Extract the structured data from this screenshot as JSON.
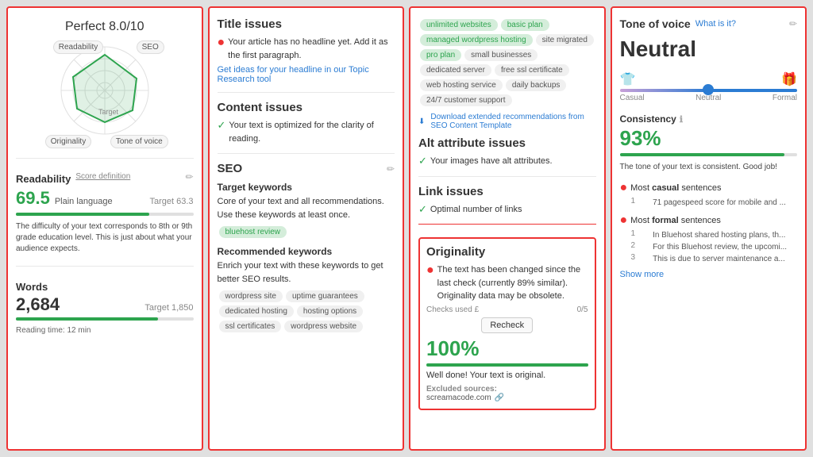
{
  "panel1": {
    "score": "Perfect 8.0",
    "score_suffix": "/10",
    "labels": {
      "readability": "Readability",
      "seo": "SEO",
      "originality": "Originality",
      "tone": "Tone of voice",
      "target": "Target"
    },
    "readability": {
      "title": "Readability",
      "score_def": "Score definition",
      "value": "69.5",
      "sublabel": "Plain language",
      "target": "Target 63.3",
      "desc": "The difficulty of your text corresponds to 8th or 9th grade education level. This is just about what your audience expects.",
      "progress": 75
    },
    "words": {
      "title": "Words",
      "value": "2,684",
      "target": "Target 1,850",
      "reading_time": "Reading time: 12 min",
      "progress": 80
    }
  },
  "panel2": {
    "title_issues": {
      "title": "Title issues",
      "text": "Your article has no headline yet. Add it as the first paragraph.",
      "link": "Get ideas for your headline in our Topic Research tool"
    },
    "content_issues": {
      "title": "Content issues",
      "text": "Your text is optimized for the clarity of reading."
    },
    "seo": {
      "title": "SEO",
      "target_keywords_title": "Target keywords",
      "target_keywords_desc": "Core of your text and all recommendations. Use these keywords at least once.",
      "target_tag": "bluehost review",
      "recommended_title": "Recommended keywords",
      "recommended_desc": "Enrich your text with these keywords to get better SEO results.",
      "recommended_tags": [
        "wordpress site",
        "uptime guarantees",
        "dedicated hosting",
        "hosting options",
        "ssl certificates",
        "wordpress website"
      ]
    }
  },
  "panel3": {
    "tags": [
      "unlimited websites",
      "basic plan",
      "managed wordpress hosting",
      "site migrated",
      "pro plan",
      "small businesses",
      "dedicated server",
      "free ssl certificate",
      "web hosting service",
      "daily backups",
      "24/7 customer support"
    ],
    "download_link": "Download extended recommendations from SEO Content Template",
    "alt_issues": {
      "title": "Alt attribute issues",
      "text": "Your images have alt attributes."
    },
    "link_issues": {
      "title": "Link issues",
      "text": "Optimal number of links"
    },
    "originality": {
      "title": "Originality",
      "warning": "The text has been changed since the last check (currently 89% similar). Originality data may be obsolete.",
      "checks_label": "Checks used",
      "checks_used": "£",
      "checks_total": "0/5",
      "recheck": "Recheck",
      "score": "100%",
      "well_done": "Well done! Your text is original.",
      "excluded_title": "Excluded sources:",
      "excluded": "screamacode.com"
    }
  },
  "panel4": {
    "tov": {
      "title": "Tone of voice",
      "what": "What is it?",
      "value": "Neutral",
      "slider_labels": [
        "Casual",
        "Neutral",
        "Formal"
      ],
      "consistency_title": "Consistency",
      "consistency_pct": "93%",
      "desc": "The tone of your text is consistent. Good job!",
      "casual_label": "Most casual sentences",
      "formal_label": "Most formal sentences",
      "casual_sentences": [
        "71 pagespeed score for mobile and ..."
      ],
      "formal_sentences": [
        "In Bluehost shared hosting plans, th...",
        "For this Bluehost review, the upcomi...",
        "This is due to server maintenance a..."
      ],
      "show_more": "Show more"
    }
  }
}
